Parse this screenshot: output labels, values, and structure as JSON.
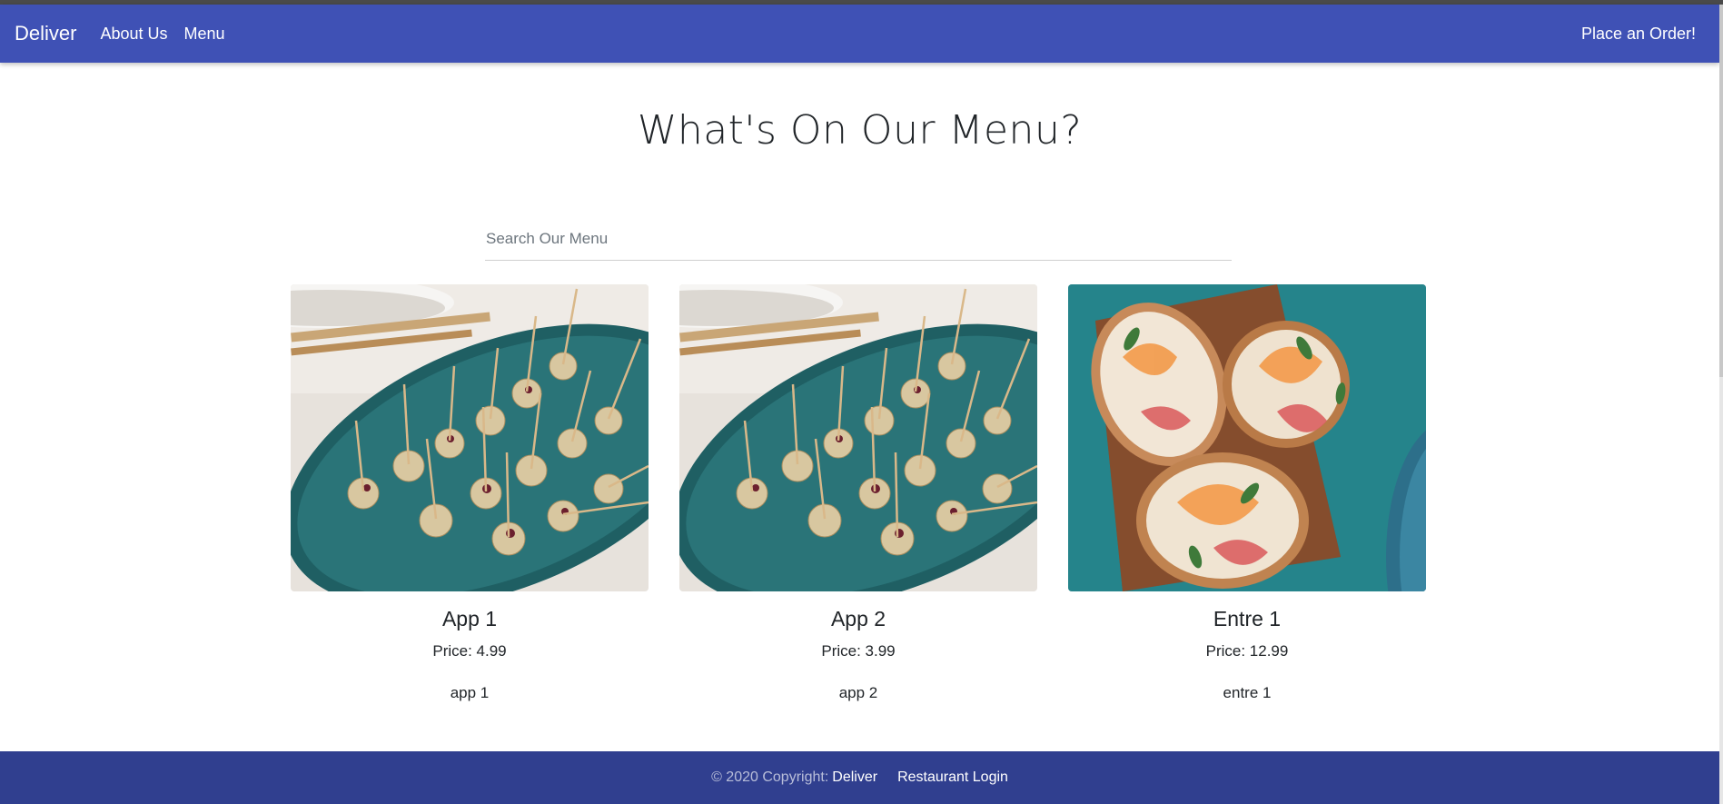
{
  "nav": {
    "brand": "Deliver",
    "links": [
      "About Us",
      "Menu"
    ],
    "cta": "Place an Order!"
  },
  "colors": {
    "navbar": "#3f51b5",
    "footer": "#303f8f"
  },
  "page": {
    "heading": "What's On Our Menu?"
  },
  "search": {
    "placeholder": "Search Our Menu",
    "value": ""
  },
  "menu_items": [
    {
      "name": "App 1",
      "price": "Price: 4.99",
      "description": "app 1",
      "image": "appetizer-bites-on-teal-plate"
    },
    {
      "name": "App 2",
      "price": "Price: 3.99",
      "description": "app 2",
      "image": "appetizer-bites-on-teal-plate"
    },
    {
      "name": "Entre 1",
      "price": "Price: 12.99",
      "description": "entre 1",
      "image": "prosciutto-melon-crostini-on-board"
    }
  ],
  "footer": {
    "copyright": "© 2020 Copyright:",
    "brand": "Deliver",
    "login": "Restaurant Login"
  }
}
